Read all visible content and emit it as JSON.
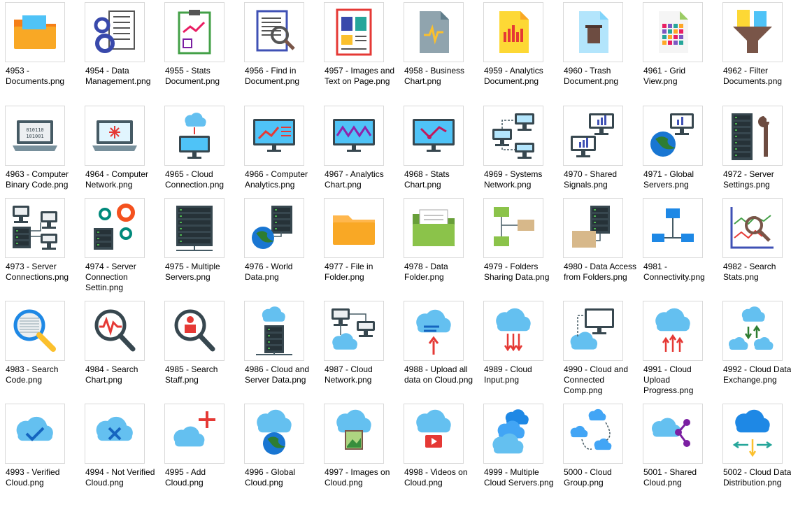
{
  "files": [
    {
      "name": "4953 - Documents.png",
      "icon": "folder-documents-icon"
    },
    {
      "name": "4954 - Data Management.png",
      "icon": "gears-document-icon"
    },
    {
      "name": "4955 - Stats Document.png",
      "icon": "clipboard-chart-icon"
    },
    {
      "name": "4956 - Find in Document.png",
      "icon": "document-magnifier-icon"
    },
    {
      "name": "4957 - Images and Text on Page.png",
      "icon": "page-layout-icon"
    },
    {
      "name": "4958 - Business Chart.png",
      "icon": "grey-document-wave-icon"
    },
    {
      "name": "4959 - Analytics Document.png",
      "icon": "yellow-document-bars-icon"
    },
    {
      "name": "4960 - Trash Document.png",
      "icon": "trash-document-icon"
    },
    {
      "name": "4961 - Grid View.png",
      "icon": "grid-document-icon"
    },
    {
      "name": "4962 - Filter Documents.png",
      "icon": "filter-funnel-icon"
    },
    {
      "name": "4963 - Computer Binary Code.png",
      "icon": "laptop-binary-icon"
    },
    {
      "name": "4964 - Computer Network.png",
      "icon": "laptop-network-icon"
    },
    {
      "name": "4965 - Cloud Connection.png",
      "icon": "monitor-cloud-icon"
    },
    {
      "name": "4966 - Computer Analytics.png",
      "icon": "monitor-analytics-icon"
    },
    {
      "name": "4967 - Analytics Chart.png",
      "icon": "monitor-zigzag-icon"
    },
    {
      "name": "4968 - Stats Chart.png",
      "icon": "monitor-stats-icon"
    },
    {
      "name": "4969 - Systems Network.png",
      "icon": "systems-network-icon"
    },
    {
      "name": "4970 - Shared Signals.png",
      "icon": "shared-monitors-icon"
    },
    {
      "name": "4971 - Global Servers.png",
      "icon": "globe-monitor-icon"
    },
    {
      "name": "4972 - Server Settings.png",
      "icon": "server-wrench-icon"
    },
    {
      "name": "4973 - Server Connections.png",
      "icon": "server-connections-icon"
    },
    {
      "name": "4974 - Server Connection Settin.png",
      "icon": "server-gears-icon"
    },
    {
      "name": "4975 - Multiple Servers.png",
      "icon": "multiple-servers-icon"
    },
    {
      "name": "4976 - World Data.png",
      "icon": "globe-server-icon"
    },
    {
      "name": "4977 - File in Folder.png",
      "icon": "orange-folder-icon"
    },
    {
      "name": "4978 - Data Folder.png",
      "icon": "green-folder-icon"
    },
    {
      "name": "4979 - Folders Sharing Data.png",
      "icon": "folders-sharing-icon"
    },
    {
      "name": "4980 - Data Access from Folders.png",
      "icon": "folder-server-icon"
    },
    {
      "name": "4981 - Connectivity.png",
      "icon": "connectivity-icon"
    },
    {
      "name": "4982 - Search Stats.png",
      "icon": "search-stats-icon"
    },
    {
      "name": "4983 - Search Code.png",
      "icon": "magnifier-code-icon"
    },
    {
      "name": "4984 - Search Chart.png",
      "icon": "magnifier-chart-icon"
    },
    {
      "name": "4985 - Search Staff.png",
      "icon": "magnifier-person-icon"
    },
    {
      "name": "4986 - Cloud and Server Data.png",
      "icon": "cloud-server-icon"
    },
    {
      "name": "4987 - Cloud Network.png",
      "icon": "cloud-network-icon"
    },
    {
      "name": "4988 - Upload all data on Cloud.png",
      "icon": "cloud-upload-icon"
    },
    {
      "name": "4989 - Cloud Input.png",
      "icon": "cloud-input-icon"
    },
    {
      "name": "4990 - Cloud and Connected Comp.png",
      "icon": "cloud-monitor-icon"
    },
    {
      "name": "4991 - Cloud Upload Progress.png",
      "icon": "cloud-upload-progress-icon"
    },
    {
      "name": "4992 - Cloud Data Exchange.png",
      "icon": "cloud-exchange-icon"
    },
    {
      "name": "4993 - Verified Cloud.png",
      "icon": "cloud-check-icon"
    },
    {
      "name": "4994 - Not Verified Cloud.png",
      "icon": "cloud-x-icon"
    },
    {
      "name": "4995 - Add Cloud.png",
      "icon": "cloud-plus-icon"
    },
    {
      "name": "4996 - Global Cloud.png",
      "icon": "cloud-globe-icon"
    },
    {
      "name": "4997 - Images on Cloud.png",
      "icon": "cloud-image-icon"
    },
    {
      "name": "4998 - Videos on Cloud.png",
      "icon": "cloud-video-icon"
    },
    {
      "name": "4999 - Multiple Cloud Servers.png",
      "icon": "multiple-clouds-icon"
    },
    {
      "name": "5000 - Cloud Group.png",
      "icon": "cloud-group-icon"
    },
    {
      "name": "5001 - Shared Cloud.png",
      "icon": "cloud-share-icon"
    },
    {
      "name": "5002 - Cloud Data Distribution.png",
      "icon": "cloud-distribution-icon"
    }
  ],
  "colors": {
    "folder_orange": "#f9a825",
    "monitor_screen": "#4fc3f7",
    "cloud_blue": "#64c0f0",
    "accent_red": "#e53935",
    "server_dark": "#37474f",
    "globe_green": "#2e7d32"
  }
}
